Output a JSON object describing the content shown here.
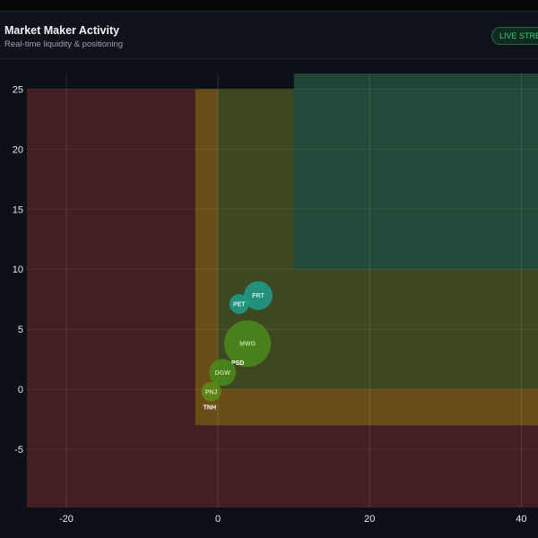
{
  "header": {
    "title": "Market Maker Activity",
    "subtitle": "Real-time liquidity & positioning",
    "badge": "LIVE STREAM"
  },
  "chart_data": {
    "type": "scatter",
    "variant": "bubble",
    "xlim": [
      -25.2,
      42.2
    ],
    "ylim": [
      -9.85,
      26.3
    ],
    "xticks": [
      -20,
      0,
      20,
      40
    ],
    "yticks": [
      -5,
      0,
      5,
      10,
      15,
      20,
      25
    ],
    "grid": true,
    "regions": [
      {
        "x": [
          -25.2,
          42.2
        ],
        "y": [
          -9.85,
          25
        ],
        "color": "#4a1f26"
      },
      {
        "x": [
          -3,
          42.2
        ],
        "y": [
          -3,
          25
        ],
        "color": "#6b5316"
      },
      {
        "x": [
          0,
          42.2
        ],
        "y": [
          0,
          25
        ],
        "color": "#3a4722"
      },
      {
        "x": [
          10,
          42.2
        ],
        "y": [
          10,
          26.3
        ],
        "color": "#1f4a3c"
      }
    ],
    "points": [
      {
        "label": "FRT",
        "x": 5.3,
        "y": 7.8,
        "size": 16,
        "color": "#1f9e8c",
        "label_color": "#cfeee9"
      },
      {
        "label": "PET",
        "x": 2.8,
        "y": 7.1,
        "size": 11,
        "color": "#1f9e8c",
        "label_color": "#cfeee9"
      },
      {
        "label": "MWG",
        "x": 3.9,
        "y": 3.8,
        "size": 26,
        "color": "#4a8c1c",
        "label_color": "#b8d99a"
      },
      {
        "label": "PSD",
        "x": 2.6,
        "y": 2.2,
        "size": 0,
        "color": "#4a8c1c",
        "label_color": "#ffffff"
      },
      {
        "label": "DGW",
        "x": 0.6,
        "y": 1.4,
        "size": 15,
        "color": "#4a8c1c",
        "label_color": "#b8d99a"
      },
      {
        "label": "PNJ",
        "x": -0.9,
        "y": -0.2,
        "size": 11,
        "color": "#5e8c1a",
        "label_color": "#c9dba0"
      },
      {
        "label": "TNH",
        "x": -1.1,
        "y": -1.5,
        "size": 0,
        "color": "#5e8c1a",
        "label_color": "#ffffff"
      }
    ]
  }
}
